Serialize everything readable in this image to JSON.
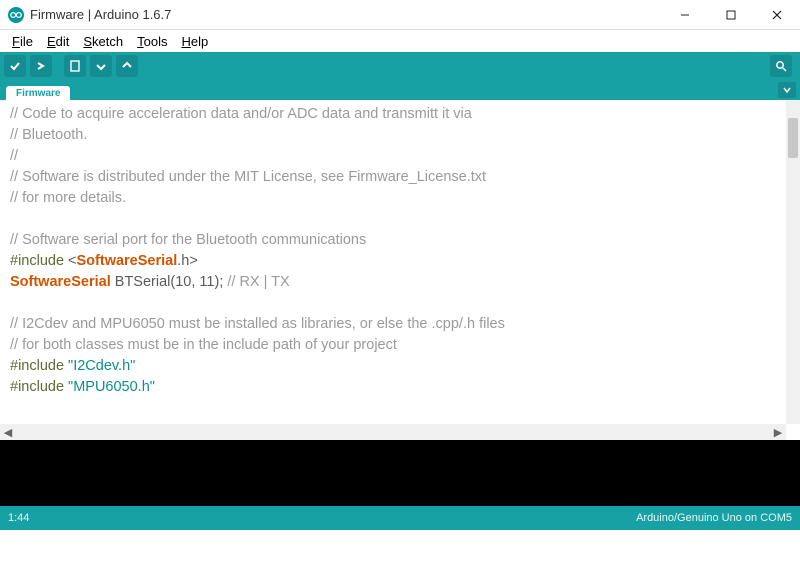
{
  "window": {
    "title": "Firmware | Arduino 1.6.7"
  },
  "menubar": {
    "items": [
      {
        "label": "File",
        "accel": "F"
      },
      {
        "label": "Edit",
        "accel": "E"
      },
      {
        "label": "Sketch",
        "accel": "S"
      },
      {
        "label": "Tools",
        "accel": "T"
      },
      {
        "label": "Help",
        "accel": "H"
      }
    ]
  },
  "toolbar": {
    "buttons": [
      "verify",
      "upload",
      "new",
      "open",
      "save"
    ],
    "serial_monitor": "serial-monitor"
  },
  "tabs": {
    "active": "Firmware"
  },
  "editor": {
    "lines": [
      {
        "t": "cmt",
        "text": "// Code to acquire acceleration data and/or ADC data and transmitt it via"
      },
      {
        "t": "cmt",
        "text": "// Bluetooth."
      },
      {
        "t": "cmt",
        "text": "//"
      },
      {
        "t": "cmt",
        "text": "// Software is distributed under the MIT License, see Firmware_License.txt"
      },
      {
        "t": "cmt",
        "text": "// for more details."
      },
      {
        "t": "blank",
        "text": ""
      },
      {
        "t": "cmt",
        "text": "// Software serial port for the Bluetooth communications"
      },
      {
        "t": "inc1",
        "pre": "#include ",
        "open": "<",
        "name": "SoftwareSerial",
        "rest": ".h>"
      },
      {
        "t": "decl",
        "type": "SoftwareSerial",
        "rest1": " BTSerial(",
        "n1": "10",
        "sep": ", ",
        "n2": "11",
        "rest2": "); ",
        "cmt": "// RX | TX"
      },
      {
        "t": "blank",
        "text": ""
      },
      {
        "t": "cmt",
        "text": "// I2Cdev and MPU6050 must be installed as libraries, or else the .cpp/.h files"
      },
      {
        "t": "cmt",
        "text": "// for both classes must be in the include path of your project"
      },
      {
        "t": "inc2",
        "pre": "#include ",
        "str": "\"I2Cdev.h\""
      },
      {
        "t": "inc2",
        "pre": "#include ",
        "str": "\"MPU6050.h\""
      }
    ]
  },
  "status": {
    "left": "1:44",
    "right": "Arduino/Genuino Uno on COM5"
  },
  "colors": {
    "teal": "#17a1a5",
    "teal_dark": "#138d91"
  }
}
